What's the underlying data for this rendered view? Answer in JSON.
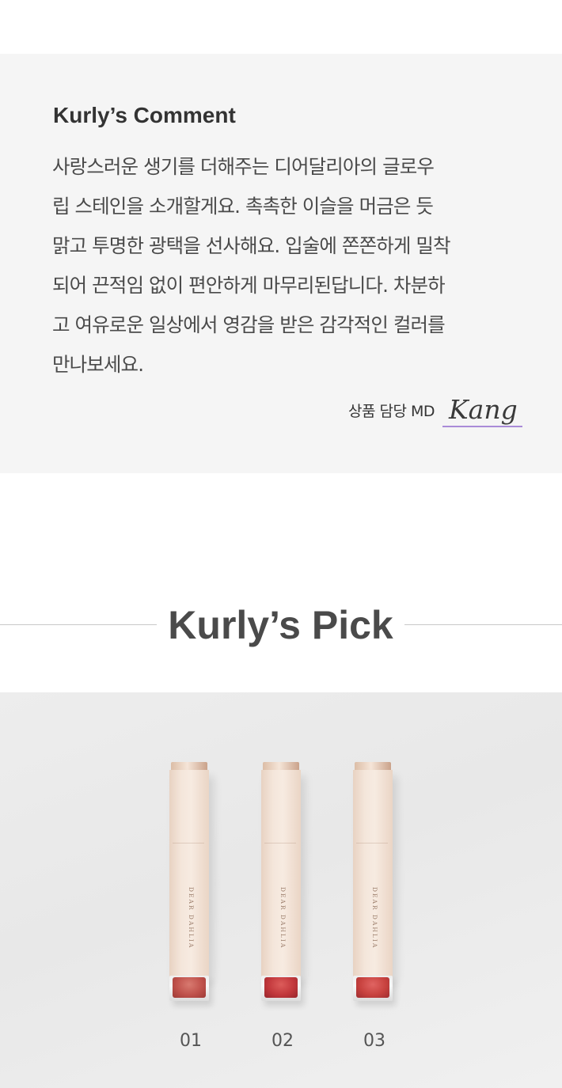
{
  "comment": {
    "heading": "Kurly’s Comment",
    "lines": [
      "사랑스러운 생기를 더해주는 디어달리아의 글로우",
      "립 스테인을 소개할게요. 촉촉한 이슬을 머금은 듯",
      "맑고 투명한 광택을 선사해요. 입술에 쫀쫀하게 밀착",
      "되어 끈적임 없이 편안하게 마무리된답니다. 차분하",
      "고 여유로운 일상에서 영감을 받은 감각적인 컬러를",
      "만나보세요."
    ],
    "signature_label": "상품 담당 MD",
    "signature_name": "Kang"
  },
  "pick": {
    "title": "Kurly’s Pick",
    "products": [
      {
        "brand": "DEAR DAHLIA",
        "shade": "01",
        "color": "#c0524c"
      },
      {
        "brand": "DEAR DAHLIA",
        "shade": "02",
        "color": "#c2383c"
      },
      {
        "brand": "DEAR DAHLIA",
        "shade": "03",
        "color": "#c8423f"
      }
    ]
  },
  "colors": {
    "comment_background": "#f5f5f5",
    "signature_underline": "#a98bd8",
    "divider": "#c8c8c8"
  }
}
